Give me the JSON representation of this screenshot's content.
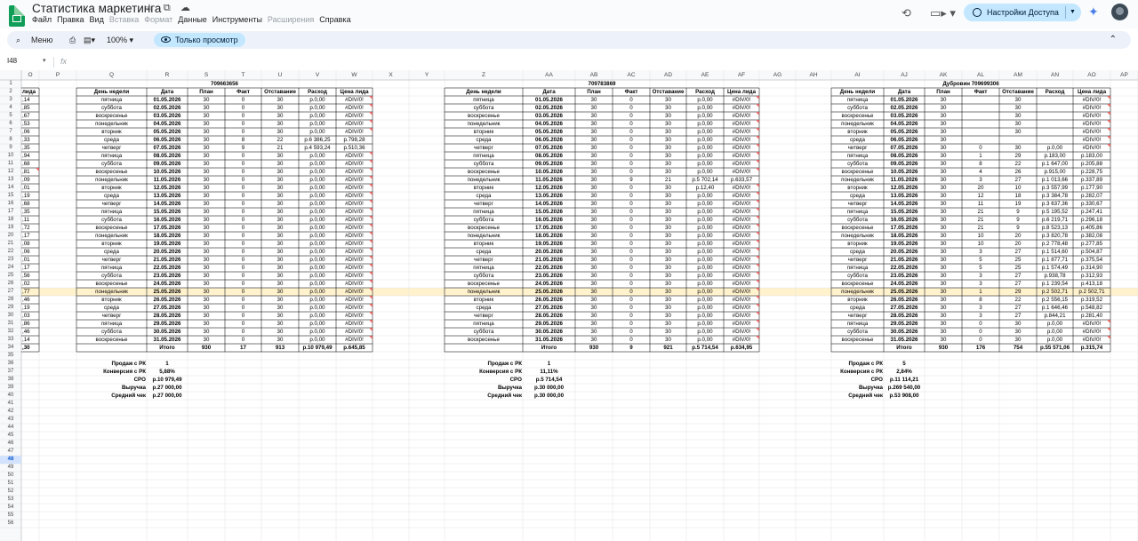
{
  "app": {
    "title": "Статистика маркетинга",
    "title_icons": "☆ ⧉ ☁",
    "menu": [
      {
        "label": "Файл",
        "enabled": true
      },
      {
        "label": "Правка",
        "enabled": true
      },
      {
        "label": "Вид",
        "enabled": true
      },
      {
        "label": "Вставка",
        "enabled": false
      },
      {
        "label": "Формат",
        "enabled": false
      },
      {
        "label": "Данные",
        "enabled": true
      },
      {
        "label": "Инструменты",
        "enabled": true
      },
      {
        "label": "Расширения",
        "enabled": false
      },
      {
        "label": "Справка",
        "enabled": true
      }
    ],
    "share_label": "Настройки Доступа",
    "share_color": "#c2e7ff",
    "history_icon": "history-icon",
    "meet_icon": "video-icon"
  },
  "toolbar": {
    "menu_label": "Меню",
    "zoom": "100%",
    "view_only": "Только просмотр",
    "search_icon": "search-icon",
    "print_icon": "print-icon",
    "collapse_icon": "chevron-up-icon"
  },
  "formula_bar": {
    "name_box": "I48",
    "fx": "fx",
    "formula": ""
  },
  "columns": {
    "letters": [
      "O",
      "P",
      "Q",
      "R",
      "S",
      "T",
      "U",
      "V",
      "W",
      "X",
      "Y",
      "Z",
      "AA",
      "AB",
      "AC",
      "AD",
      "AE",
      "AF",
      "AG",
      "AH",
      "AI",
      "AJ",
      "AK",
      "AL",
      "AM",
      "AN",
      "AO",
      "AP"
    ]
  },
  "rows": {
    "numbers": [
      1,
      2,
      3,
      4,
      5,
      6,
      7,
      8,
      9,
      10,
      11,
      12,
      13,
      14,
      15,
      16,
      17,
      18,
      19,
      20,
      21,
      22,
      23,
      24,
      25,
      26,
      27,
      28,
      29,
      30,
      31,
      32,
      33,
      34,
      35,
      36,
      37,
      38,
      39,
      40,
      41,
      42,
      43,
      44,
      45,
      46,
      47,
      48,
      49,
      50,
      51,
      52,
      53,
      54,
      55,
      56
    ],
    "selected": 48,
    "highlighted": 27
  },
  "col_o_values": [
    "лида",
    ",14",
    ",85",
    ",67",
    ",53",
    ",06",
    ",33",
    ",35",
    ",94",
    ",68",
    ",81",
    ",09",
    ",01",
    ",19",
    ",68",
    ",35",
    ",11",
    ",72",
    ",17",
    ",08",
    ",06",
    ",01",
    ",17",
    ",56",
    ",02",
    ",77",
    ",46",
    ",19",
    ",03",
    ",86",
    ",46",
    ",14",
    ",30"
  ],
  "headers": [
    "День недели",
    "Дата",
    "План",
    "Факт",
    "Отставание",
    "Расход",
    "Цена лида"
  ],
  "weekdays": [
    "пятница",
    "суббота",
    "воскресенье",
    "понедельник",
    "вторник",
    "среда",
    "четверг",
    "пятница",
    "суббота",
    "воскресенье",
    "понедельник",
    "вторник",
    "среда",
    "четверг",
    "пятница",
    "суббота",
    "воскресенье",
    "понедельник",
    "вторник",
    "среда",
    "четверг",
    "пятница",
    "суббота",
    "воскресенье",
    "понедельник",
    "вторник",
    "среда",
    "четверг",
    "пятница",
    "суббота",
    "воскресенье"
  ],
  "dates": [
    "01.05.2026",
    "02.05.2026",
    "03.05.2026",
    "04.05.2026",
    "05.05.2026",
    "06.05.2026",
    "07.05.2026",
    "08.05.2026",
    "09.05.2026",
    "10.05.2026",
    "11.05.2026",
    "12.05.2026",
    "13.05.2026",
    "14.05.2026",
    "15.05.2026",
    "16.05.2026",
    "17.05.2026",
    "18.05.2026",
    "19.05.2026",
    "20.05.2026",
    "21.05.2026",
    "22.05.2026",
    "23.05.2026",
    "24.05.2026",
    "25.05.2026",
    "26.05.2026",
    "27.05.2026",
    "28.05.2026",
    "29.05.2026",
    "30.05.2026",
    "31.05.2026"
  ],
  "blocks": [
    {
      "title": "709663656",
      "plan": [
        "30",
        "30",
        "30",
        "30",
        "30",
        "30",
        "30",
        "30",
        "30",
        "30",
        "30",
        "30",
        "30",
        "30",
        "30",
        "30",
        "30",
        "30",
        "30",
        "30",
        "30",
        "30",
        "30",
        "30",
        "30",
        "30",
        "30",
        "30",
        "30",
        "30",
        "30"
      ],
      "fact": [
        "0",
        "0",
        "0",
        "0",
        "0",
        "8",
        "9",
        "0",
        "0",
        "0",
        "0",
        "0",
        "0",
        "0",
        "0",
        "0",
        "0",
        "0",
        "0",
        "0",
        "0",
        "0",
        "0",
        "0",
        "0",
        "0",
        "0",
        "0",
        "0",
        "0",
        "0"
      ],
      "lag": [
        "30",
        "30",
        "30",
        "30",
        "30",
        "22",
        "21",
        "30",
        "30",
        "30",
        "30",
        "30",
        "30",
        "30",
        "30",
        "30",
        "30",
        "30",
        "30",
        "30",
        "30",
        "30",
        "30",
        "30",
        "30",
        "30",
        "30",
        "30",
        "30",
        "30",
        "30"
      ],
      "spend": [
        "р.0,00",
        "р.0,00",
        "р.0,00",
        "р.0,00",
        "р.0,00",
        "р.6 386,25",
        "р.4 593,24",
        "р.0,00",
        "р.0,00",
        "р.0,00",
        "р.0,00",
        "р.0,00",
        "р.0,00",
        "р.0,00",
        "р.0,00",
        "р.0,00",
        "р.0,00",
        "р.0,00",
        "р.0,00",
        "р.0,00",
        "р.0,00",
        "р.0,00",
        "р.0,00",
        "р.0,00",
        "р.0,00",
        "р.0,00",
        "р.0,00",
        "р.0,00",
        "р.0,00",
        "р.0,00",
        "р.0,00"
      ],
      "cpl": [
        "#DIV/0!",
        "#DIV/0!",
        "#DIV/0!",
        "#DIV/0!",
        "#DIV/0!",
        "р.798,28",
        "р.510,36",
        "#DIV/0!",
        "#DIV/0!",
        "#DIV/0!",
        "#DIV/0!",
        "#DIV/0!",
        "#DIV/0!",
        "#DIV/0!",
        "#DIV/0!",
        "#DIV/0!",
        "#DIV/0!",
        "#DIV/0!",
        "#DIV/0!",
        "#DIV/0!",
        "#DIV/0!",
        "#DIV/0!",
        "#DIV/0!",
        "#DIV/0!",
        "#DIV/0!",
        "#DIV/0!",
        "#DIV/0!",
        "#DIV/0!",
        "#DIV/0!",
        "#DIV/0!",
        "#DIV/0!"
      ],
      "total": {
        "label": "Итого",
        "plan": "930",
        "fact": "17",
        "lag": "913",
        "spend": "р.10 979,49",
        "cpl": "р.645,85"
      },
      "summary": [
        {
          "label": "Продаж с РК",
          "value": "1"
        },
        {
          "label": "Конверсия с РК",
          "value": "5,88%"
        },
        {
          "label": "CPO",
          "value": "р.10 979,49"
        },
        {
          "label": "Выручка",
          "value": "р.27 000,00"
        },
        {
          "label": "Средний чек",
          "value": "р.27 000,00"
        }
      ]
    },
    {
      "title": "709783869",
      "plan": [
        "30",
        "30",
        "30",
        "30",
        "30",
        "30",
        "30",
        "30",
        "30",
        "30",
        "30",
        "30",
        "30",
        "30",
        "30",
        "30",
        "30",
        "30",
        "30",
        "30",
        "30",
        "30",
        "30",
        "30",
        "30",
        "30",
        "30",
        "30",
        "30",
        "30",
        "30"
      ],
      "fact": [
        "0",
        "0",
        "0",
        "0",
        "0",
        "0",
        "0",
        "0",
        "0",
        "0",
        "9",
        "0",
        "0",
        "0",
        "0",
        "0",
        "0",
        "0",
        "0",
        "0",
        "0",
        "0",
        "0",
        "0",
        "0",
        "0",
        "0",
        "0",
        "0",
        "0",
        "0"
      ],
      "lag": [
        "30",
        "30",
        "30",
        "30",
        "30",
        "30",
        "30",
        "30",
        "30",
        "30",
        "21",
        "30",
        "30",
        "30",
        "30",
        "30",
        "30",
        "30",
        "30",
        "30",
        "30",
        "30",
        "30",
        "30",
        "30",
        "30",
        "30",
        "30",
        "30",
        "30",
        "30"
      ],
      "spend": [
        "р.0,00",
        "р.0,00",
        "р.0,00",
        "р.0,00",
        "р.0,00",
        "р.0,00",
        "р.0,00",
        "р.0,00",
        "р.0,00",
        "р.0,00",
        "р.5 702,14",
        "р.12,40",
        "р.0,00",
        "р.0,00",
        "р.0,00",
        "р.0,00",
        "р.0,00",
        "р.0,00",
        "р.0,00",
        "р.0,00",
        "р.0,00",
        "р.0,00",
        "р.0,00",
        "р.0,00",
        "р.0,00",
        "р.0,00",
        "р.0,00",
        "р.0,00",
        "р.0,00",
        "р.0,00",
        "р.0,00"
      ],
      "cpl": [
        "#DIV/0!",
        "#DIV/0!",
        "#DIV/0!",
        "#DIV/0!",
        "#DIV/0!",
        "#DIV/0!",
        "#DIV/0!",
        "#DIV/0!",
        "#DIV/0!",
        "#DIV/0!",
        "р.633,57",
        "#DIV/0!",
        "#DIV/0!",
        "#DIV/0!",
        "#DIV/0!",
        "#DIV/0!",
        "#DIV/0!",
        "#DIV/0!",
        "#DIV/0!",
        "#DIV/0!",
        "#DIV/0!",
        "#DIV/0!",
        "#DIV/0!",
        "#DIV/0!",
        "#DIV/0!",
        "#DIV/0!",
        "#DIV/0!",
        "#DIV/0!",
        "#DIV/0!",
        "#DIV/0!",
        "#DIV/0!"
      ],
      "total": {
        "label": "Итого",
        "plan": "930",
        "fact": "9",
        "lag": "921",
        "spend": "р.5 714,54",
        "cpl": "р.634,95"
      },
      "summary": [
        {
          "label": "Продаж с РК",
          "value": "1"
        },
        {
          "label": "Конверсия с РК",
          "value": "11,11%"
        },
        {
          "label": "CPO",
          "value": "р.5 714,54"
        },
        {
          "label": "Выручка",
          "value": "р.30 000,00"
        },
        {
          "label": "Средний чек",
          "value": "р.30 000,00"
        }
      ]
    },
    {
      "title": "Дубровин 709699306",
      "plan": [
        "30",
        "30",
        "30",
        "30",
        "30",
        "30",
        "30",
        "30",
        "30",
        "30",
        "30",
        "30",
        "30",
        "30",
        "30",
        "30",
        "30",
        "30",
        "30",
        "30",
        "30",
        "30",
        "30",
        "30",
        "30",
        "30",
        "30",
        "30",
        "30",
        "30",
        "30"
      ],
      "fact": [
        "",
        "",
        "",
        "",
        "",
        "",
        "0",
        "1",
        "8",
        "4",
        "3",
        "20",
        "12",
        "11",
        "21",
        "21",
        "21",
        "10",
        "10",
        "3",
        "5",
        "5",
        "3",
        "3",
        "1",
        "8",
        "3",
        "3",
        "0",
        "0",
        "0"
      ],
      "lag": [
        "30",
        "30",
        "30",
        "30",
        "30",
        "",
        "30",
        "29",
        "22",
        "26",
        "27",
        "10",
        "18",
        "19",
        "9",
        "9",
        "9",
        "20",
        "20",
        "27",
        "25",
        "25",
        "27",
        "27",
        "29",
        "22",
        "27",
        "27",
        "30",
        "30",
        "30"
      ],
      "spend": [
        "",
        "",
        "",
        "",
        "",
        "",
        "р.0,00",
        "р.183,00",
        "р.1 647,00",
        "р.915,00",
        "р.1 013,66",
        "р.3 557,99",
        "р.3 384,78",
        "р.3 637,36",
        "р.5 195,52",
        "р.6 219,71",
        "р.8 523,13",
        "р.3 820,78",
        "р.2 778,48",
        "р.1 514,60",
        "р.1 877,71",
        "р.1 574,49",
        "р.938,78",
        "р.1 239,54",
        "р.2 502,71",
        "р.2 556,15",
        "р.1 646,46",
        "р.844,21",
        "р.0,00",
        "р.0,00",
        "р.0,00"
      ],
      "cpl": [
        "#DIV/0!",
        "#DIV/0!",
        "#DIV/0!",
        "#DIV/0!",
        "#DIV/0!",
        "#DIV/0!",
        "#DIV/0!",
        "р.183,00",
        "р.205,88",
        "р.228,75",
        "р.337,89",
        "р.177,90",
        "р.282,07",
        "р.330,67",
        "р.247,41",
        "р.296,18",
        "р.405,86",
        "р.382,08",
        "р.277,85",
        "р.504,87",
        "р.375,54",
        "р.314,90",
        "р.312,93",
        "р.413,18",
        "р.2 502,71",
        "р.319,52",
        "р.548,82",
        "р.281,40",
        "#DIV/0!",
        "#DIV/0!",
        "#DIV/0!"
      ],
      "total": {
        "label": "Итого",
        "plan": "930",
        "fact": "176",
        "lag": "754",
        "spend": "р.55 571,06",
        "cpl": "р.315,74"
      },
      "summary": [
        {
          "label": "Продаж с РК",
          "value": "5"
        },
        {
          "label": "Конверсия с РК",
          "value": "2,84%"
        },
        {
          "label": "CPO",
          "value": "р.11 114,21"
        },
        {
          "label": "Выручка",
          "value": "р.269 540,00"
        },
        {
          "label": "Средний чек",
          "value": "р.53 908,00"
        }
      ]
    }
  ]
}
